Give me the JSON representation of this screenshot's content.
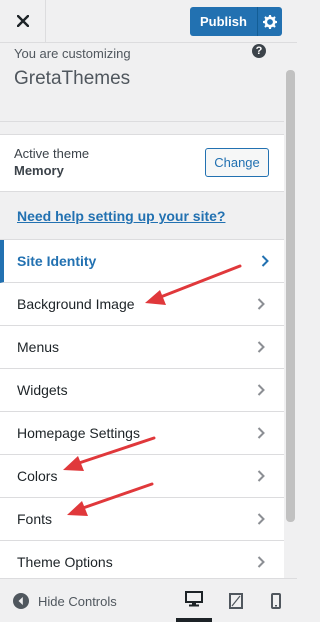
{
  "header": {
    "publish_label": "Publish"
  },
  "info": {
    "customizing_label": "You are customizing",
    "site_name": "GretaThemes",
    "help_icon_glyph": "?"
  },
  "theme": {
    "active_label": "Active theme",
    "name": "Memory",
    "change_label": "Change"
  },
  "help_link": "Need help setting up your site?",
  "menu": {
    "items": [
      {
        "label": "Site Identity"
      },
      {
        "label": "Background Image"
      },
      {
        "label": "Menus"
      },
      {
        "label": "Widgets"
      },
      {
        "label": "Homepage Settings"
      },
      {
        "label": "Colors"
      },
      {
        "label": "Fonts"
      },
      {
        "label": "Theme Options"
      }
    ]
  },
  "footer": {
    "hide_controls_label": "Hide Controls"
  },
  "colors": {
    "accent": "#2271b1",
    "annotation_arrow": "#e0383b"
  },
  "icons": [
    "close-icon",
    "gear-icon",
    "help-icon",
    "chevron-right-icon",
    "collapse-icon",
    "desktop-icon",
    "tablet-icon",
    "mobile-icon"
  ]
}
